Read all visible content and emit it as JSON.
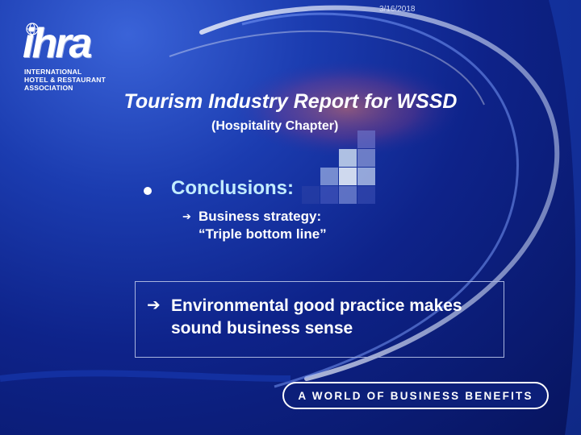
{
  "header": {
    "date": "3/16/2018"
  },
  "logo": {
    "wordmark": "ihra",
    "lines": [
      "International",
      "Hotel & Restaurant",
      "Association"
    ]
  },
  "slide": {
    "title": "Tourism Industry Report for WSSD",
    "subtitle": "(Hospitality Chapter)",
    "bullet_heading": "Conclusions:",
    "sub_bullet_line1": "Business strategy:",
    "sub_bullet_line2": "“Triple bottom line”",
    "highlight_line1": "Environmental good practice makes",
    "highlight_line2": "sound business sense"
  },
  "footer": {
    "banner": "A WORLD OF BUSINESS BENEFITS"
  },
  "colors": {
    "background": "#0e238a",
    "title": "#ffffff",
    "heading": "#c2ecff",
    "swoosh": "#ffffff",
    "swoosh_glow": "#ff6a4a"
  },
  "icons": {
    "bullet": "filled-circle",
    "sub_bullet": "right-arrow",
    "highlight_bullet": "right-arrow"
  }
}
